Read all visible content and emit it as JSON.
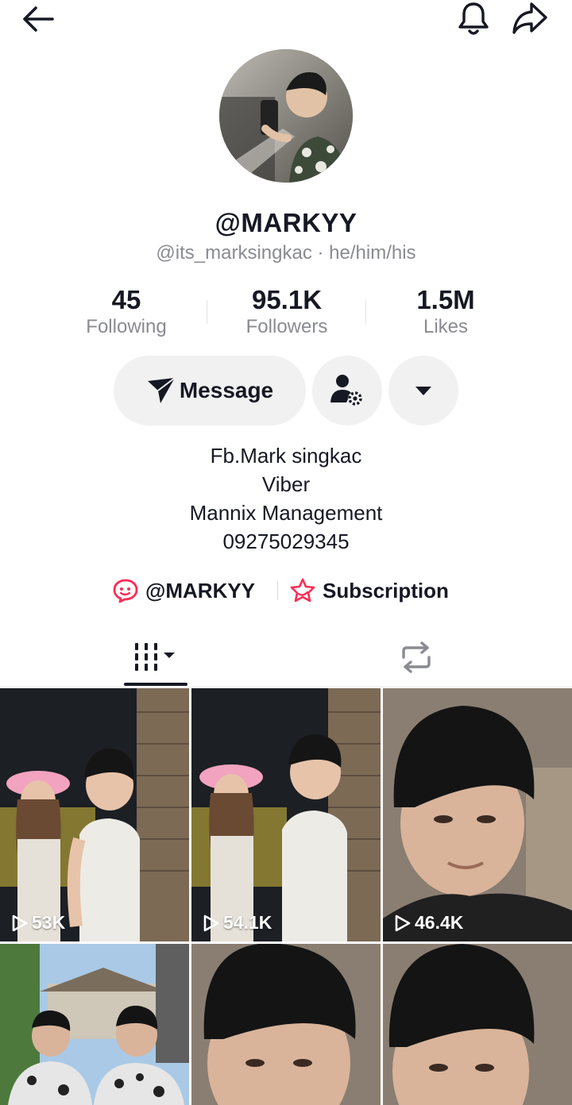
{
  "profile": {
    "display_name": "@MARKYY",
    "handle_line": "@its_marksingkac · he/him/his"
  },
  "stats": [
    {
      "value": "45",
      "label": "Following"
    },
    {
      "value": "95.1K",
      "label": "Followers"
    },
    {
      "value": "1.5M",
      "label": "Likes"
    }
  ],
  "actions": {
    "message_label": "Message"
  },
  "bio": {
    "lines": [
      "Fb.Mark singkac",
      "Viber",
      "Mannix Management",
      "09275029345"
    ]
  },
  "links": {
    "lemon8_label": "@MARKYY",
    "subscription_label": "Subscription"
  },
  "videos": [
    {
      "views": "53K"
    },
    {
      "views": "54.1K"
    },
    {
      "views": "46.4K"
    },
    {
      "views": ""
    },
    {
      "views": ""
    },
    {
      "views": ""
    }
  ],
  "colors": {
    "text_primary": "#161823",
    "text_secondary": "#8a8b91",
    "button_bg": "#f1f1f2",
    "accent_pink": "#fe2c55"
  },
  "icons": {
    "back": "arrow-left-icon",
    "bell": "bell-icon",
    "share": "share-arrow-icon",
    "message": "paper-plane-icon",
    "add_friend": "person-gear-icon",
    "dropdown": "caret-down-icon",
    "lemon8": "lemon8-icon",
    "subscription": "star-icon",
    "grid_tab": "grid-bars-icon",
    "repost_tab": "repost-icon",
    "play": "play-icon"
  }
}
